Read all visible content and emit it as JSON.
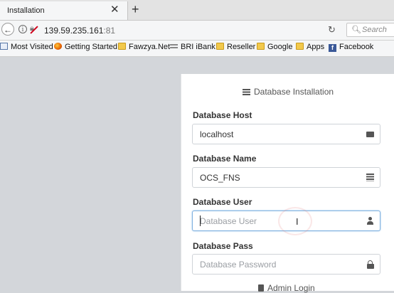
{
  "browser": {
    "tab_title": "Installation",
    "url_host": "139.59.235.161",
    "url_port": ":81",
    "search_placeholder": "Search",
    "bookmarks": [
      "Most Visited",
      "Getting Started",
      "Fawzya.Net",
      "BRI iBank",
      "Reseller",
      "Google",
      "Apps",
      "Facebook"
    ]
  },
  "form": {
    "heading": "Database Installation",
    "host_label": "Database Host",
    "host_value": "localhost",
    "name_label": "Database Name",
    "name_value": "OCS_FNS",
    "user_label": "Database User",
    "user_placeholder": "Database User",
    "pass_label": "Database Pass",
    "pass_placeholder": "Database Password",
    "admin_heading": "Admin Login"
  },
  "icons": {
    "back": "back-arrow-icon",
    "info": "info-icon",
    "reload": "reload-icon",
    "search": "search-icon",
    "host": "hdd-icon",
    "name": "database-icon",
    "user": "user-icon",
    "pass": "lock-icon"
  }
}
